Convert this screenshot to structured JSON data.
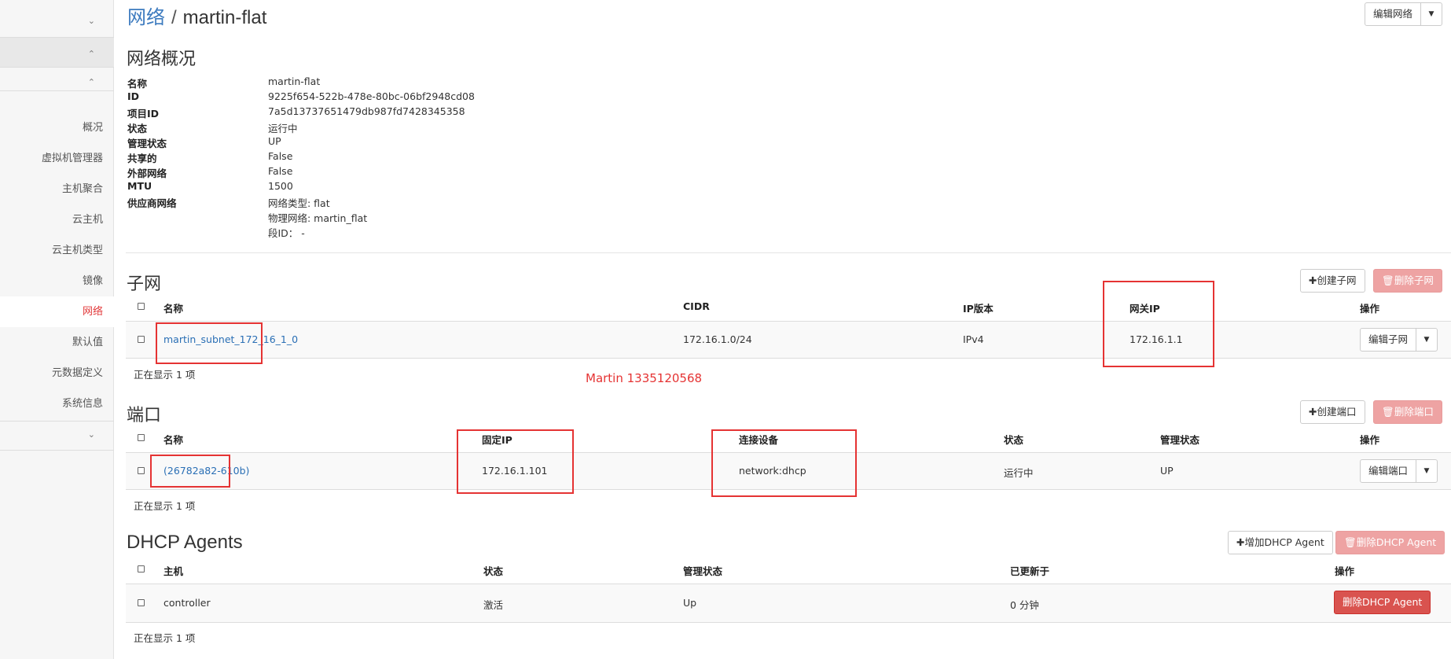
{
  "sidebar": {
    "items": [
      {
        "label": "概况"
      },
      {
        "label": "虚拟机管理器"
      },
      {
        "label": "主机聚合"
      },
      {
        "label": "云主机"
      },
      {
        "label": "云主机类型"
      },
      {
        "label": "镜像"
      },
      {
        "label": "网络",
        "active": true
      },
      {
        "label": "默认值"
      },
      {
        "label": "元数据定义"
      },
      {
        "label": "系统信息"
      }
    ]
  },
  "header": {
    "breadcrumb_link": "网络",
    "separator": "/",
    "current": "martin-flat",
    "edit_button": "编辑网络"
  },
  "overview": {
    "title": "网络概况",
    "rows": [
      {
        "label": "名称",
        "value": "martin-flat"
      },
      {
        "label": "ID",
        "value": "9225f654-522b-478e-80bc-06bf2948cd08"
      },
      {
        "label": "项目ID",
        "value": "7a5d13737651479db987fd7428345358"
      },
      {
        "label": "状态",
        "value": "运行中"
      },
      {
        "label": "管理状态",
        "value": "UP"
      },
      {
        "label": "共享的",
        "value": "False"
      },
      {
        "label": "外部网络",
        "value": "False"
      },
      {
        "label": "MTU",
        "value": "1500"
      },
      {
        "label": "供应商网络",
        "value": "网络类型: flat"
      }
    ],
    "provider_extra": [
      "物理网络: martin_flat",
      "段ID： -"
    ]
  },
  "subnets": {
    "title": "子网",
    "create_button": "创建子网",
    "delete_button": "删除子网",
    "headers": [
      "名称",
      "CIDR",
      "IP版本",
      "网关IP",
      "操作"
    ],
    "rows": [
      {
        "name": "martin_subnet_172_16_1_0",
        "cidr": "172.16.1.0/24",
        "ip_version": "IPv4",
        "gateway": "172.16.1.1",
        "action": "编辑子网"
      }
    ],
    "footer": "正在显示 1 项"
  },
  "watermark": "Martin 1335120568",
  "ports": {
    "title": "端口",
    "create_button": "创建端口",
    "delete_button": "删除端口",
    "headers": [
      "名称",
      "固定IP",
      "连接设备",
      "状态",
      "管理状态",
      "操作"
    ],
    "rows": [
      {
        "name": "(26782a82-610b)",
        "fixed_ip": "172.16.1.101",
        "device": "network:dhcp",
        "status": "运行中",
        "admin_state": "UP",
        "action": "编辑端口"
      }
    ],
    "footer": "正在显示 1 项"
  },
  "dhcp": {
    "title": "DHCP Agents",
    "add_button": "增加DHCP Agent",
    "delete_button": "删除DHCP Agent",
    "headers": [
      "主机",
      "状态",
      "管理状态",
      "已更新于",
      "操作"
    ],
    "rows": [
      {
        "host": "controller",
        "status": "激活",
        "admin_state": "Up",
        "updated": "0 分钟",
        "action": "删除DHCP Agent"
      }
    ],
    "footer": "正在显示 1 项"
  },
  "colors": {
    "accent": "#3d7bbf",
    "danger": "#d9534f",
    "annotation": "#e53333",
    "active_nav": "#e2393a"
  }
}
